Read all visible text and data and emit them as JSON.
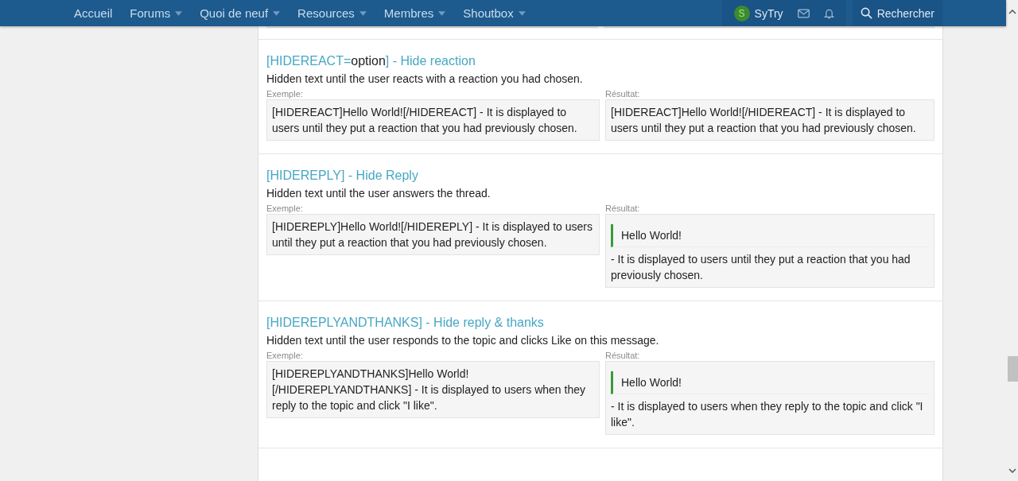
{
  "nav": {
    "items": [
      {
        "label": "Accueil",
        "dropdown": false
      },
      {
        "label": "Forums",
        "dropdown": true
      },
      {
        "label": "Quoi de neuf",
        "dropdown": true
      },
      {
        "label": "Resources",
        "dropdown": true
      },
      {
        "label": "Membres",
        "dropdown": true
      },
      {
        "label": "Shoutbox",
        "dropdown": true
      }
    ],
    "user": {
      "initial": "S",
      "name": "SyTry"
    },
    "search": {
      "label": "Rechercher"
    }
  },
  "sections": [
    {
      "title": [
        {
          "text": "[HIDEREACT=",
          "highlight": true
        },
        {
          "text": "option",
          "highlight": false
        },
        {
          "text": "] - Hide reaction",
          "highlight": true
        }
      ],
      "description": "Hidden text until the user reacts with a reaction you had chosen.",
      "example_label": "Exemple:",
      "example": "[HIDEREACT]Hello World![/HIDEREACT] - It is displayed to users until they put a reaction that you had previously chosen.",
      "result_label": "Résultat:",
      "result": {
        "kind": "plain",
        "text": "[HIDEREACT]Hello World![/HIDEREACT] - It is displayed to users until they put a reaction that you had previously chosen."
      }
    },
    {
      "title": [
        {
          "text": "[HIDEREPLY] - Hide Reply",
          "highlight": true
        }
      ],
      "description": "Hidden text until the user answers the thread.",
      "example_label": "Exemple:",
      "example": "[HIDEREPLY]Hello World![/HIDEREPLY] - It is displayed to users until they put a reaction that you had previously chosen.",
      "result_label": "Résultat:",
      "result": {
        "kind": "quote",
        "quote": "Hello World!",
        "text": "- It is displayed to users until they put a reaction that you had previously chosen."
      }
    },
    {
      "title": [
        {
          "text": "[HIDEREPLYANDTHANKS] - Hide reply & thanks",
          "highlight": true
        }
      ],
      "description": "Hidden text until the user responds to the topic and clicks Like on this message.",
      "example_label": "Exemple:",
      "example": "[HIDEREPLYANDTHANKS]Hello World![/HIDEREPLYANDTHANKS] - It is displayed to users when they reply to the topic and click \"I like\".",
      "result_label": "Résultat:",
      "result": {
        "kind": "quote",
        "quote": "Hello World!",
        "text": "- It is displayed to users when they reply to the topic and click \"I like\"."
      }
    }
  ]
}
